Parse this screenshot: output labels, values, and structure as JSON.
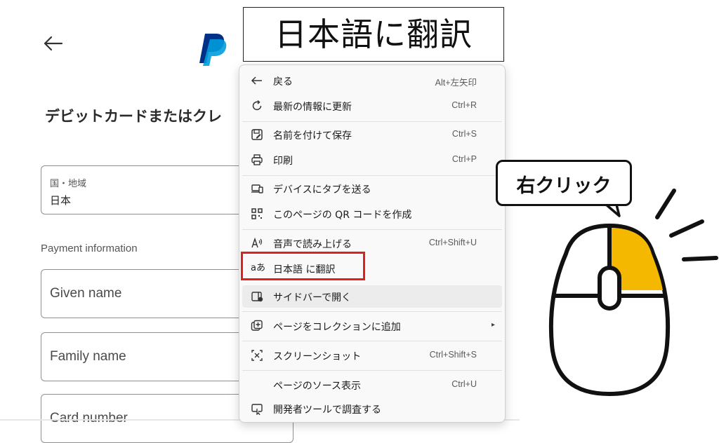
{
  "banner": {
    "title": "日本語に翻訳"
  },
  "page": {
    "heading": "デビットカードまたはクレ",
    "country_label": "国・地域",
    "country_value": "日本",
    "payment_info": "Payment information",
    "given_name_placeholder": "Given name",
    "family_name_placeholder": "Family name",
    "card_number_placeholder": "Card number"
  },
  "menu": {
    "back": {
      "label": "戻る",
      "shortcut": "Alt+左矢印",
      "icon": "back-arrow-icon"
    },
    "refresh": {
      "label": "最新の情報に更新",
      "shortcut": "Ctrl+R",
      "icon": "refresh-icon"
    },
    "save_as": {
      "label": "名前を付けて保存",
      "shortcut": "Ctrl+S",
      "icon": "save-icon"
    },
    "print": {
      "label": "印刷",
      "shortcut": "Ctrl+P",
      "icon": "printer-icon"
    },
    "send_tab": {
      "label": "デバイスにタブを送る",
      "icon": "devices-icon"
    },
    "qr_code": {
      "label": "このページの QR コードを作成",
      "icon": "qr-code-icon"
    },
    "read_aloud": {
      "label": "音声で読み上げる",
      "shortcut": "Ctrl+Shift+U",
      "icon": "read-aloud-icon"
    },
    "translate": {
      "label": "日本語 に翻訳",
      "icon": "translate-icon",
      "icon_text": "aあ"
    },
    "sidebar": {
      "label": "サイドバーで開く",
      "icon": "sidebar-icon"
    },
    "collections": {
      "label": "ページをコレクションに追加",
      "icon": "collections-icon",
      "submenu": "▸"
    },
    "screenshot": {
      "label": "スクリーンショット",
      "shortcut": "Ctrl+Shift+S",
      "icon": "screenshot-icon"
    },
    "view_source": {
      "label": "ページのソース表示",
      "shortcut": "Ctrl+U"
    },
    "devtools": {
      "label": "開発者ツールで調査する",
      "icon": "devtools-icon"
    }
  },
  "callout": {
    "text": "右クリック"
  },
  "colors": {
    "highlight": "#e0201b",
    "mouse_button": "#f5b800",
    "brand_dark": "#003087",
    "brand_light": "#009cde"
  }
}
